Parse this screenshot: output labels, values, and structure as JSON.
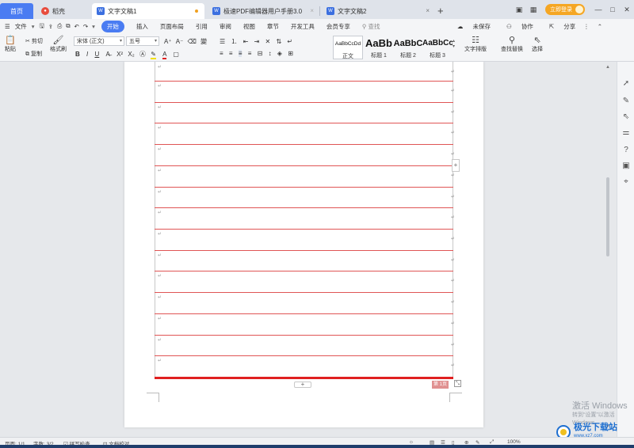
{
  "tabs": {
    "home": "首页",
    "items": [
      {
        "label": "稻壳",
        "icon_color": "#e84c3d"
      },
      {
        "label": "文字文稿1",
        "icon_color": "#3b6fe0",
        "active": true
      },
      {
        "label": "极速PDF编辑器用户手册3.0",
        "icon_color": "#3b6fe0"
      },
      {
        "label": "文字文稿2",
        "icon_color": "#3b6fe0"
      }
    ],
    "login": "立即登录"
  },
  "menu": {
    "file": "文件",
    "items": [
      "开始",
      "插入",
      "页面布局",
      "引用",
      "审阅",
      "视图",
      "章节",
      "开发工具",
      "会员专享"
    ],
    "search": "查找",
    "unsaved": "未保存",
    "collab": "协作",
    "share": "分享"
  },
  "ribbon": {
    "paste": "粘贴",
    "cut": "剪切",
    "copy": "复制",
    "format_painter": "格式刷",
    "font_name": "宋体 (正文)",
    "font_size": "五号",
    "styles": [
      {
        "sample": "AaBbCcDd",
        "name": "正文"
      },
      {
        "sample": "AaBb",
        "name": "标题 1"
      },
      {
        "sample": "AaBbC",
        "name": "标题 2"
      },
      {
        "sample": "AaBbCc",
        "name": "标题 3"
      }
    ],
    "text_layout": "文字排版",
    "find_replace": "查找替换",
    "select": "选择"
  },
  "document": {
    "para_mark": "↵",
    "page_label": "第 1页"
  },
  "watermark": {
    "line1": "激活 Windows",
    "line2": "转到“设置”以激活 Windows。",
    "brand": "极光下载站",
    "brand_url": "www.xz7.com"
  },
  "status": {
    "page": "页面: 1/1",
    "words": "字数: 3/2",
    "spell": "拼写检查",
    "proof": "文档校对",
    "zoom": "100%"
  },
  "colors": {
    "accent": "#4a7cf2",
    "table_line": "#e05555",
    "login": "#f5a623"
  }
}
